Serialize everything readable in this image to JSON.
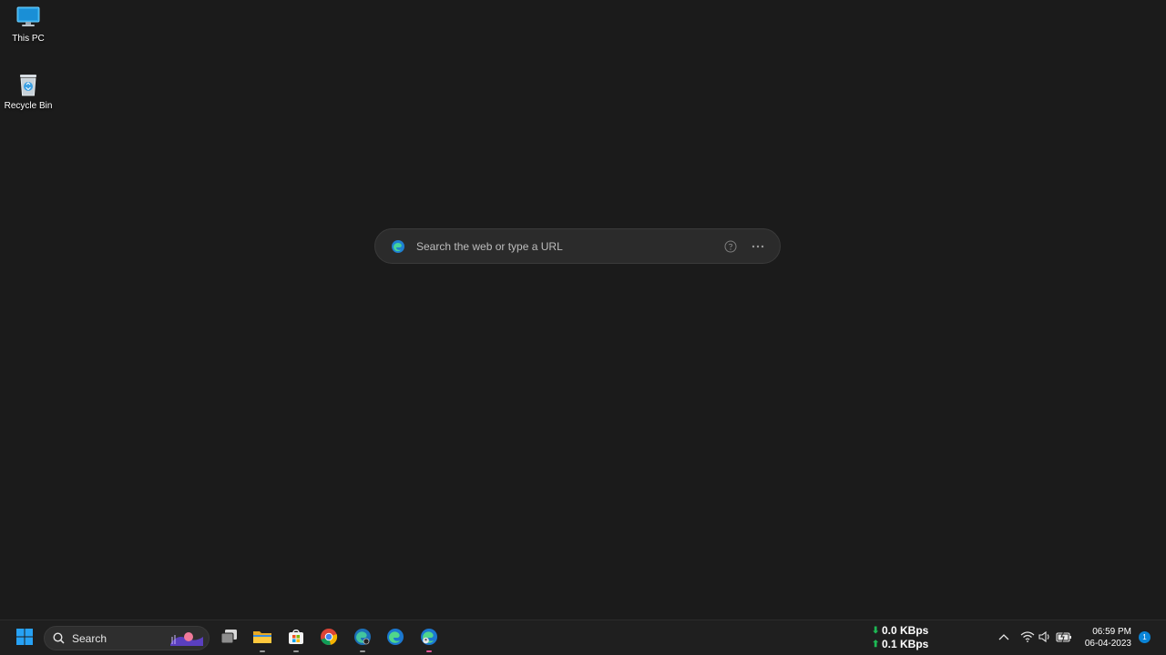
{
  "desktop": {
    "icons": [
      {
        "label": "This PC",
        "icon": "monitor-icon"
      },
      {
        "label": "Recycle Bin",
        "icon": "recycle-bin-icon"
      }
    ]
  },
  "newtab": {
    "search_placeholder": "Search the web or type a URL",
    "help_icon": "help-icon",
    "more_icon": "more-options-icon"
  },
  "taskbar": {
    "search_label": "Search",
    "apps": [
      {
        "name": "start-button",
        "icon": "windows-logo-icon"
      },
      {
        "name": "task-view",
        "icon": "task-view-icon"
      },
      {
        "name": "file-explorer",
        "icon": "folder-icon"
      },
      {
        "name": "microsoft-store",
        "icon": "store-icon"
      },
      {
        "name": "chrome",
        "icon": "chrome-icon"
      },
      {
        "name": "edge-dev",
        "icon": "edge-dev-icon"
      },
      {
        "name": "edge",
        "icon": "edge-icon"
      },
      {
        "name": "edge-profile",
        "icon": "edge-profile-icon"
      }
    ],
    "network": {
      "download": "0.0 KBps",
      "upload": "0.1 KBps"
    },
    "clock": {
      "time": "06:59 PM",
      "date": "06-04-2023"
    },
    "notification_count": "1"
  },
  "colors": {
    "desktop_bg": "#1b1b1b",
    "taskbar_bg": "#1f1f1f",
    "accent": "#0a84d6",
    "net_arrow": "#1db954"
  }
}
